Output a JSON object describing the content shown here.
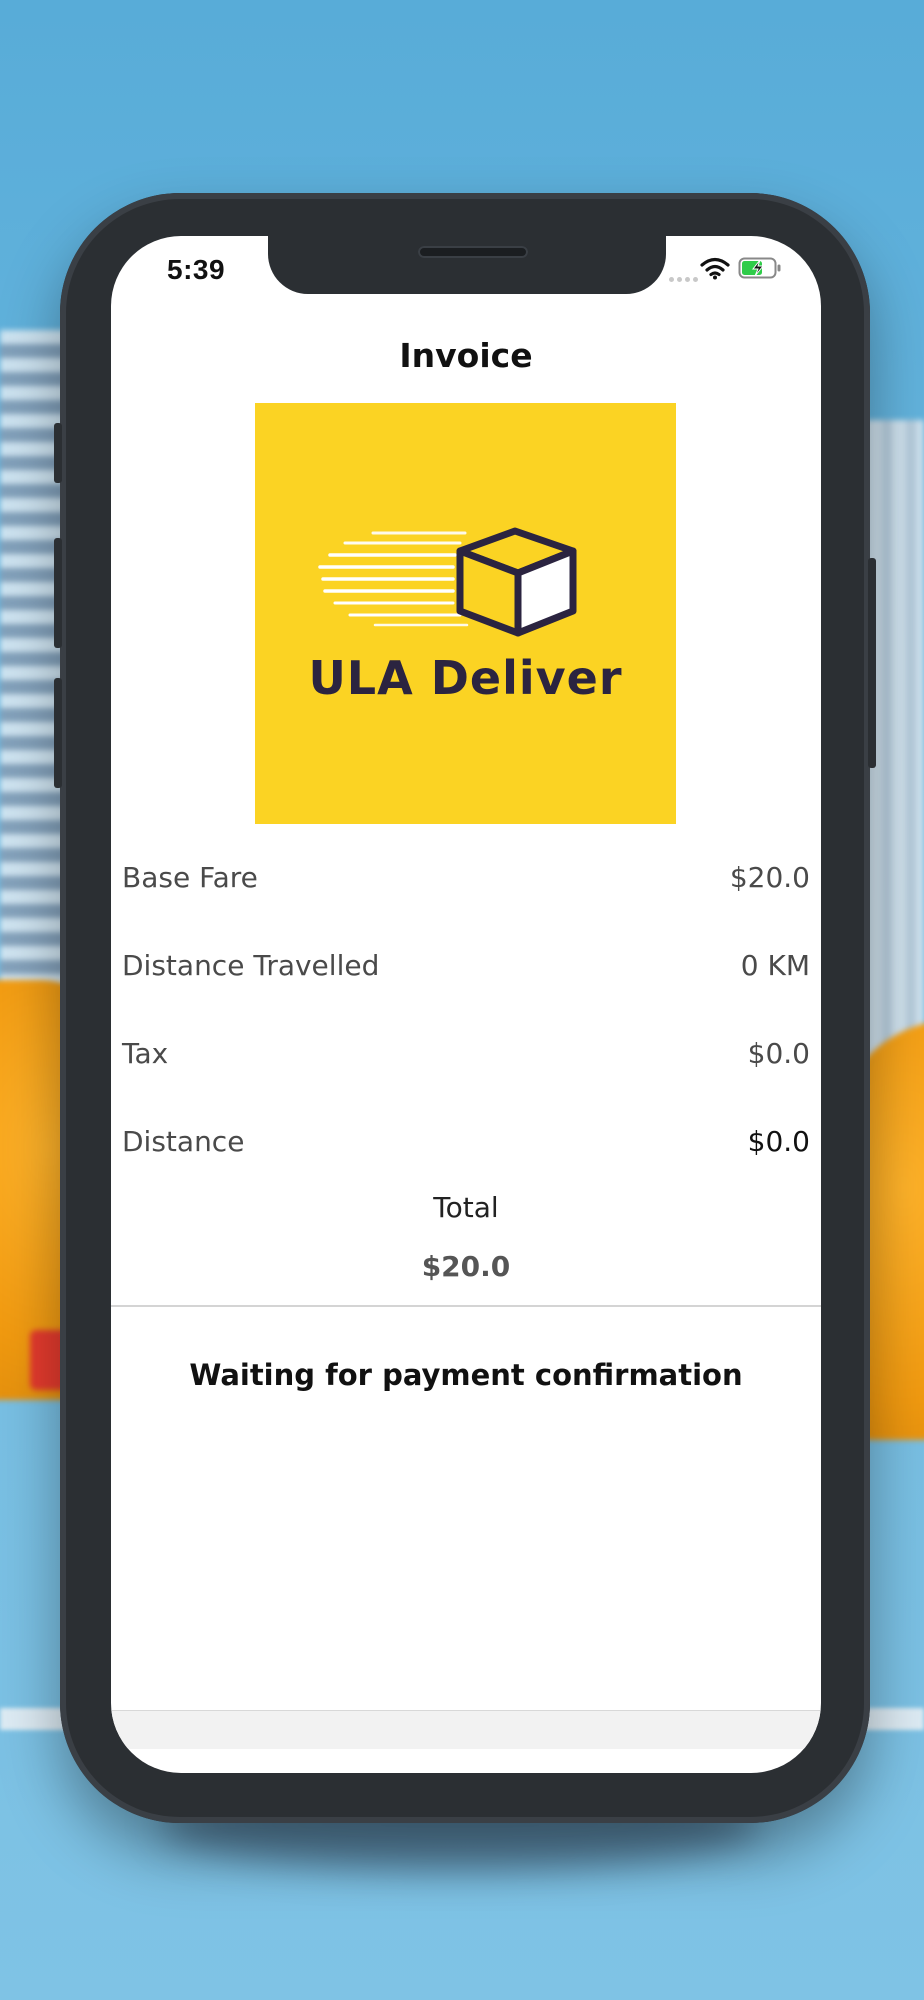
{
  "status_bar": {
    "time": "5:39"
  },
  "invoice": {
    "title": "Invoice",
    "logo_text": "ULA Deliver",
    "rows": [
      {
        "label": "Base Fare",
        "value": "$20.0"
      },
      {
        "label": "Distance Travelled",
        "value": "0 KM"
      },
      {
        "label": "Tax",
        "value": "$0.0"
      },
      {
        "label": "Distance",
        "value": "$0.0"
      }
    ],
    "total_label": "Total",
    "total_value": "$20.0",
    "status_message": "Waiting for payment confirmation"
  },
  "colors": {
    "logo_background": "#fbd323",
    "logo_ink": "#2b2440",
    "battery_charge": "#2fcc49"
  },
  "icons": [
    "location-arrow-icon",
    "wifi-icon",
    "battery-charging-icon",
    "delivery-box-icon"
  ]
}
